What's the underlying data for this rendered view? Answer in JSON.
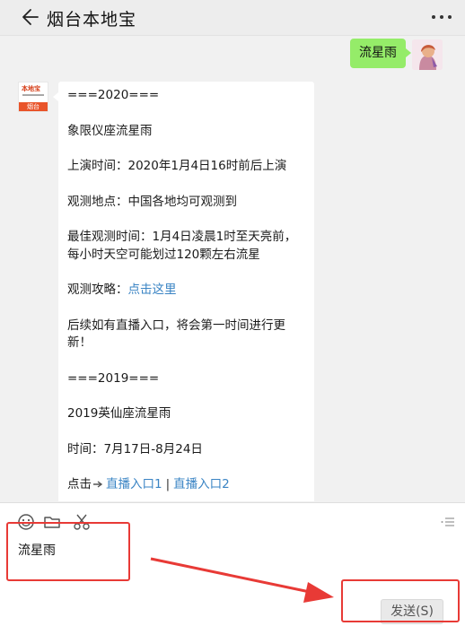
{
  "header": {
    "title": "烟台本地宝"
  },
  "chat": {
    "sent_message": "流星雨",
    "avatar_logo": {
      "brand": "本地宝",
      "city": "烟台"
    },
    "reply": {
      "p1": "===2020===",
      "p2": "象限仪座流星雨",
      "p3": "上演时间：2020年1月4日16时前后上演",
      "p4": "观测地点：中国各地均可观测到",
      "p5": "最佳观测时间：1月4日凌晨1时至天亮前，每小时天空可能划过120颗左右流星",
      "p6_label": "观测攻略：",
      "p6_link": "点击这里",
      "p7": "后续如有直播入口，将会第一时间进行更新！",
      "p8": "===2019===",
      "p9": "2019英仙座流星雨",
      "p10": "时间：7月17日-8月24日",
      "p11_label": "点击",
      "p11_link1": "直播入口1",
      "p11_sep": "|",
      "p11_link2": "直播入口2"
    }
  },
  "composer": {
    "input_value": "流星雨",
    "send_label": "发送(S)"
  },
  "icons": {
    "back": "back-arrow-icon",
    "more": "more-dots-icon",
    "emoji": "emoji-icon",
    "folder": "folder-icon",
    "scissors": "scissors-icon",
    "history": "chat-history-icon",
    "pointer": "hand-pointer-icon"
  },
  "colors": {
    "bubble_green": "#95ec69",
    "link_blue": "#3a84c4",
    "highlight_red": "#e83a36",
    "logo_orange": "#e9542a"
  }
}
